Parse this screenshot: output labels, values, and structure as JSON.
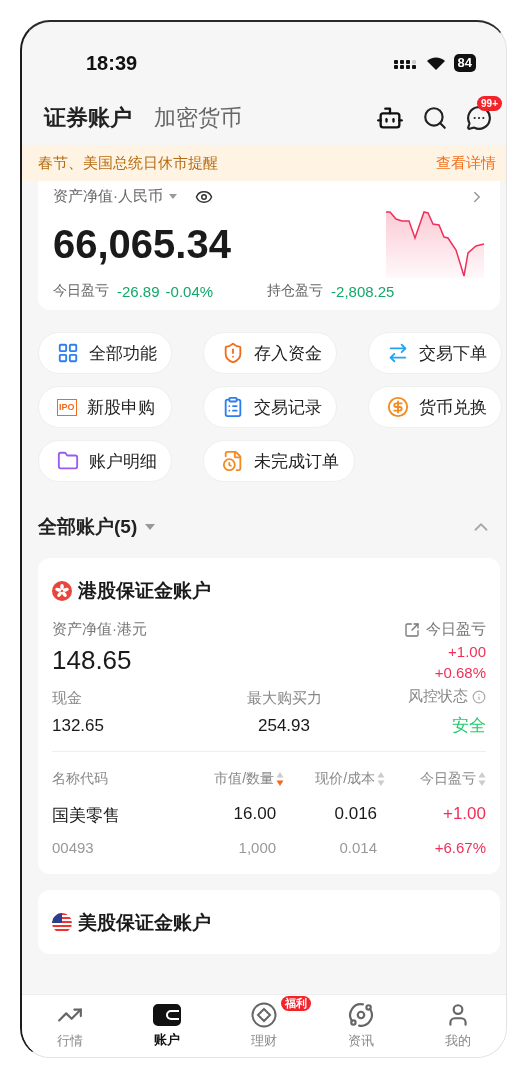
{
  "status_bar": {
    "time": "18:39",
    "battery": "84"
  },
  "header": {
    "tabs": [
      {
        "label": "证券账户",
        "selected": true
      },
      {
        "label": "加密货币",
        "selected": false
      }
    ],
    "message_badge": "99+"
  },
  "notice": {
    "text": "春节、美国总统日休市提醒",
    "link": "查看详情"
  },
  "assets": {
    "label": "资产净值·人民币",
    "value": "66,065.34",
    "positive": false,
    "today_label": "今日盈亏",
    "today_change": "-26.89",
    "today_percent": "-0.04%",
    "position_label": "持仓盈亏",
    "position_change": "-2,808.25"
  },
  "shortcuts": [
    {
      "label": "全部功能",
      "kind": "grid"
    },
    {
      "label": "存入资金",
      "kind": "deposit"
    },
    {
      "label": "交易下单",
      "kind": "trade"
    },
    {
      "label": "新股申购",
      "kind": "ipo",
      "icon_text": "IPO"
    },
    {
      "label": "交易记录",
      "kind": "record"
    },
    {
      "label": "货币兑换",
      "kind": "exchange"
    },
    {
      "label": "账户明细",
      "kind": "folder"
    },
    {
      "label": "未完成订单",
      "kind": "orders"
    }
  ],
  "accounts_header": {
    "title": "全部账户(5)",
    "expanded": true
  },
  "accounts": [
    {
      "kind": "hk",
      "title": "港股保证金账户",
      "net_label": "资产净值·港元",
      "net_value": "148.65",
      "today_label": "今日盈亏",
      "today_change": "+1.00",
      "today_percent": "+0.68%",
      "positive": true,
      "stats": [
        {
          "label": "现金",
          "value": "132.65",
          "safe": false,
          "info": false
        },
        {
          "label": "最大购买力",
          "value": "254.93",
          "safe": false,
          "info": false
        },
        {
          "label": "风控状态",
          "value": "安全",
          "safe": true,
          "info": true
        }
      ],
      "columns": [
        {
          "label": "名称代码",
          "sortable": false
        },
        {
          "label": "市值/数量",
          "sortable": true,
          "sorted": true
        },
        {
          "label": "现价/成本",
          "sortable": true,
          "sorted": false
        },
        {
          "label": "今日盈亏",
          "sortable": true,
          "sorted": false
        }
      ],
      "positions": [
        {
          "name": "国美零售",
          "code": "00493",
          "market_value": "16.00",
          "quantity": "1,000",
          "price": "0.016",
          "cost": "0.014",
          "change": "+1.00",
          "change_percent": "+6.67%",
          "positive": true
        }
      ]
    },
    {
      "kind": "us",
      "title": "美股保证金账户"
    }
  ],
  "tab_bar": [
    {
      "label": "行情",
      "kind": "chart",
      "selected": false
    },
    {
      "label": "账户",
      "kind": "wallet",
      "selected": true
    },
    {
      "label": "理财",
      "kind": "coin",
      "selected": false,
      "badge": "福利"
    },
    {
      "label": "资讯",
      "kind": "planet",
      "selected": false
    },
    {
      "label": "我的",
      "kind": "person",
      "selected": false
    }
  ]
}
